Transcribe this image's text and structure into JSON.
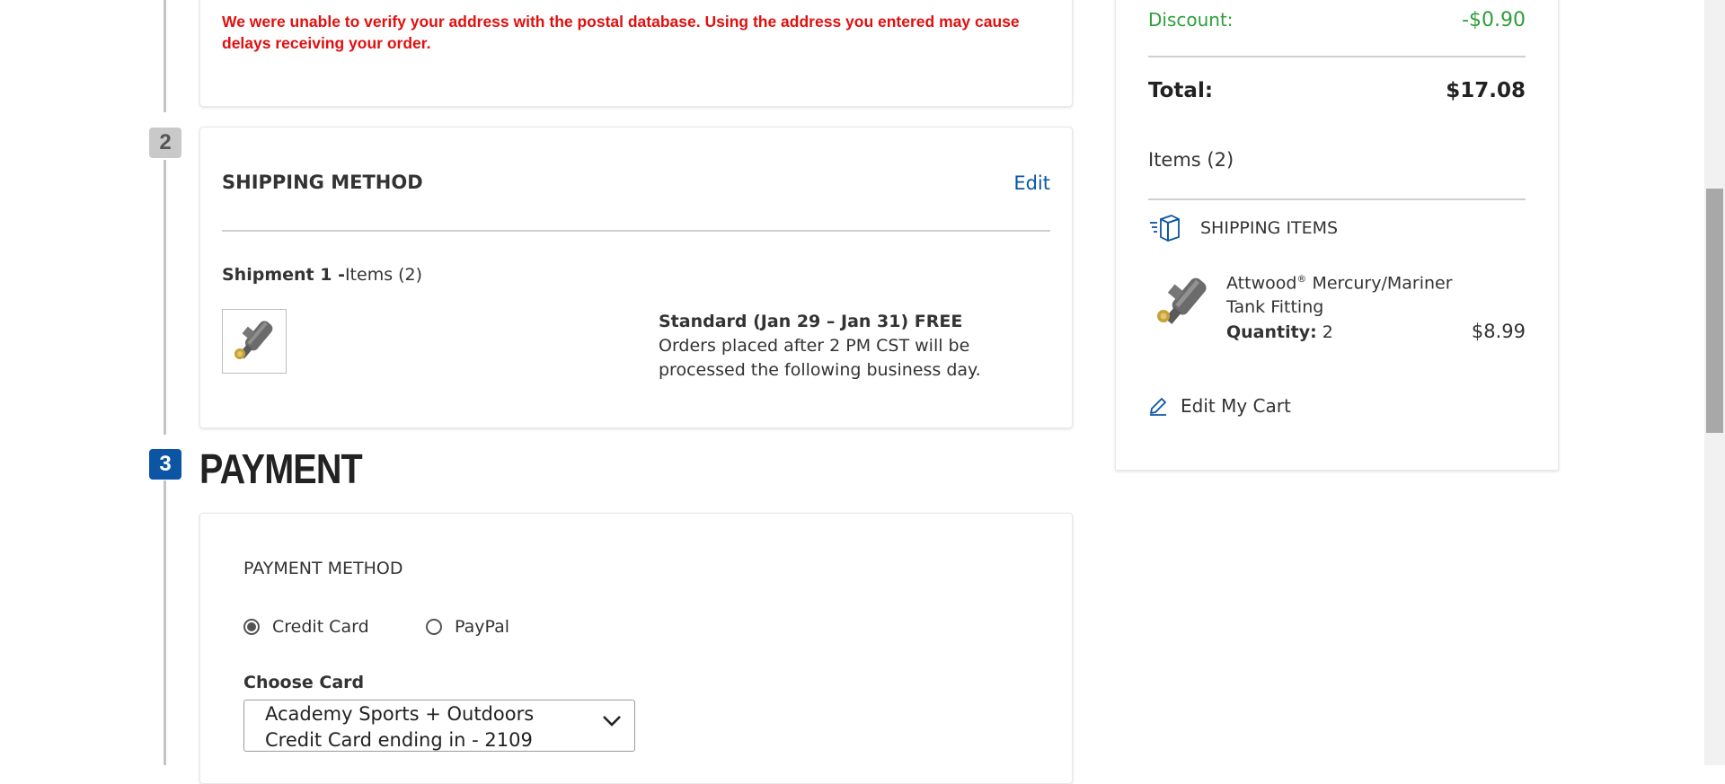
{
  "address_card": {
    "warning": "We were unable to verify your address with the postal database. Using the address you entered may cause delays receiving your order."
  },
  "steps": {
    "shipping_number": "2",
    "payment_number": "3"
  },
  "shipping_method": {
    "title": "SHIPPING METHOD",
    "edit_label": "Edit",
    "shipment_label": "Shipment 1 -",
    "shipment_items": "Items (2)",
    "delivery_title": "Standard (Jan 29 – Jan 31) FREE",
    "delivery_note": "Orders placed after 2 PM CST will be processed the following business day."
  },
  "payment": {
    "heading": "PAYMENT",
    "method_label": "PAYMENT METHOD",
    "options": [
      "Credit Card",
      "PayPal"
    ],
    "selected_option": "Credit Card",
    "choose_card_label": "Choose Card",
    "selected_card": "Academy Sports + Outdoors Credit Card ending in - 2109"
  },
  "order_summary": {
    "discount_label": "Discount:",
    "discount_value": "-$0.90",
    "total_label": "Total:",
    "total_value": "$17.08",
    "items_count": "Items (2)",
    "shipping_items_label": "SHIPPING ITEMS",
    "item": {
      "name": "Attwood",
      "trademark": "®",
      "name_rest": " Mercury/Mariner Tank Fitting",
      "quantity_label": "Quantity:",
      "quantity": "2",
      "price": "$8.99"
    },
    "edit_cart_label": "Edit My Cart"
  },
  "colors": {
    "accent_blue": "#0b55a4",
    "error_red": "#e1100f",
    "discount_green": "#2e9e3a"
  },
  "icons": [
    "package-icon",
    "pencil-icon",
    "chevron-down-icon",
    "radio-selected-icon",
    "radio-unselected-icon"
  ]
}
